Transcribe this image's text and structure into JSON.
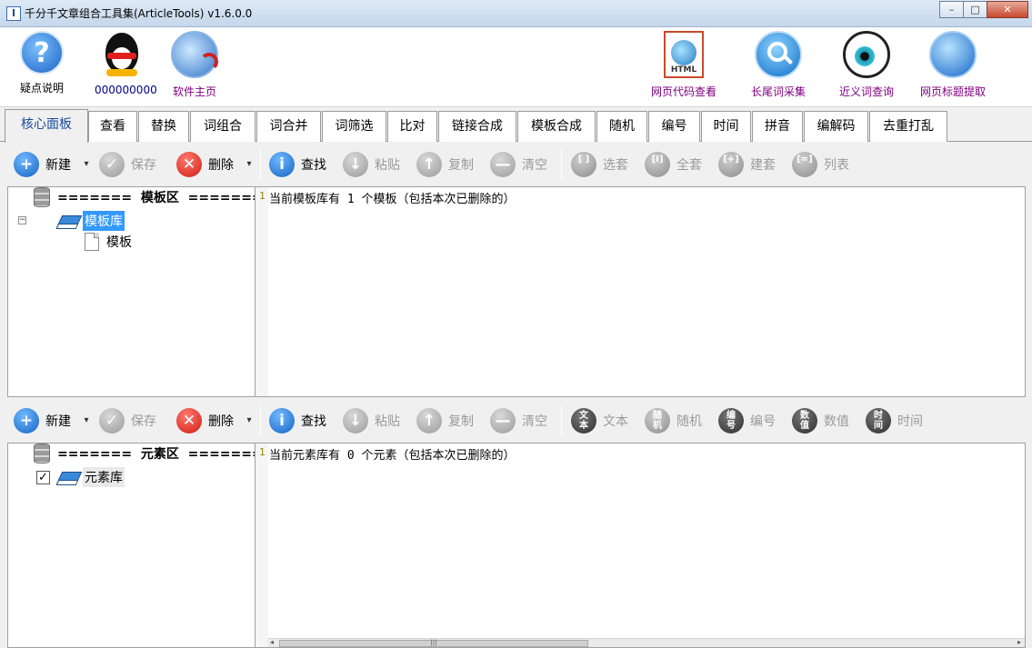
{
  "window": {
    "title": "千分千文章组合工具集(ArticleTools) v1.6.0.0",
    "app_icon_glyph": "I",
    "minimize": "–",
    "maximize": "□",
    "close": "✕"
  },
  "launcher": {
    "help": "疑点说明",
    "qq": "000000000",
    "homepage": "软件主页",
    "html_view": "网页代码查看",
    "longtail": "长尾词采集",
    "synonym": "近义词查询",
    "title_extract": "网页标题提取",
    "html_badge": "HTML",
    "help_glyph": "?"
  },
  "tabs": [
    "核心面板",
    "查看",
    "替换",
    "词组合",
    "词合并",
    "词筛选",
    "比对",
    "链接合成",
    "模板合成",
    "随机",
    "编号",
    "时间",
    "拼音",
    "编解码",
    "去重打乱"
  ],
  "toolbar_top": {
    "new": "新建",
    "save": "保存",
    "delete": "删除",
    "find": "查找",
    "paste": "粘贴",
    "copy": "复制",
    "clear": "清空",
    "select_set": "选套",
    "all_set": "全套",
    "build_set": "建套",
    "list": "列表"
  },
  "toolbar_bottom": {
    "new": "新建",
    "save": "保存",
    "delete": "删除",
    "find": "查找",
    "paste": "粘贴",
    "copy": "复制",
    "clear": "清空",
    "text": "文本",
    "random": "随机",
    "number": "编号",
    "value": "数值",
    "time": "时间"
  },
  "icon_glyphs": {
    "plus": "+",
    "check": "✓",
    "x": "✕",
    "info": "i",
    "down": "↓",
    "up": "↑",
    "minus": "—",
    "caret": "▾",
    "text_badge": "文\n本",
    "random_badge": "随\n机",
    "number_badge": "编\n号",
    "value_badge": "数\n值",
    "time_badge": "时\n间"
  },
  "template_tree": {
    "header": "=======  模板区  =======",
    "library": "模板库",
    "item": "模板",
    "expander": "−"
  },
  "template_editor": {
    "line_no": "1",
    "text": "当前模板库有 1 个模板（包括本次已删除的）"
  },
  "element_tree": {
    "header": "=======  元素区  =======",
    "library": "元素库",
    "checked": "✓"
  },
  "element_editor": {
    "line_no": "1",
    "text": "当前元素库有 0 个元素（包括本次已删除的）"
  },
  "scrollbar": {
    "left": "◂",
    "right": "▸",
    "grip": "|||"
  },
  "colors": {
    "accent": "#1a4b9c",
    "selection": "#3399ff",
    "launcher_label": "#800080"
  }
}
